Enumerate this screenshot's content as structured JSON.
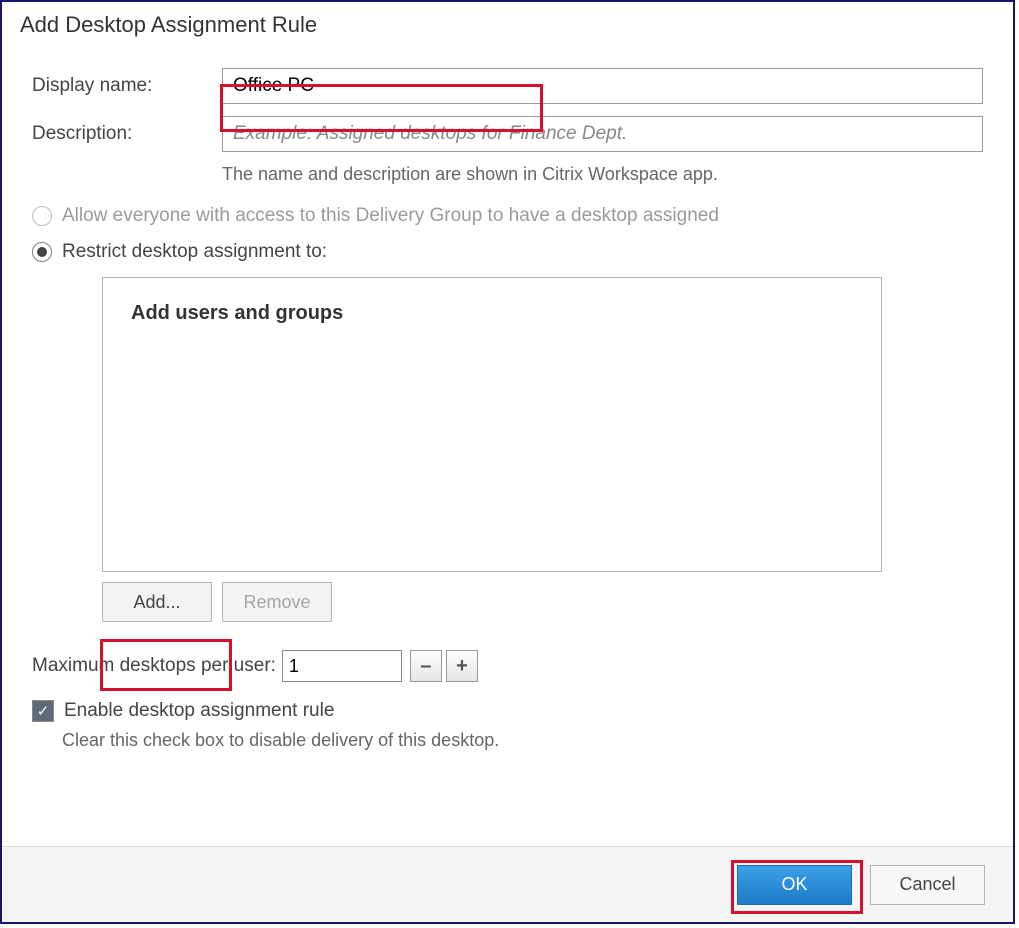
{
  "dialog": {
    "title": "Add Desktop Assignment Rule",
    "display_name_label": "Display name:",
    "display_name_value": "Office PC",
    "description_label": "Description:",
    "description_placeholder": "Example: Assigned desktops for Finance Dept.",
    "name_help": "The name and description are shown in Citrix Workspace app.",
    "radio_allow_everyone": "Allow everyone with access to this Delivery Group to have a desktop assigned",
    "radio_restrict": "Restrict desktop assignment to:",
    "users_box_title": "Add users and groups",
    "add_button": "Add...",
    "remove_button": "Remove",
    "max_label": "Maximum desktops per user:",
    "max_value": "1",
    "minus": "–",
    "plus": "+",
    "enable_label": "Enable desktop assignment rule",
    "enable_help": "Clear this check box to disable delivery of this desktop.",
    "checkmark": "✓",
    "ok": "OK",
    "cancel": "Cancel"
  }
}
